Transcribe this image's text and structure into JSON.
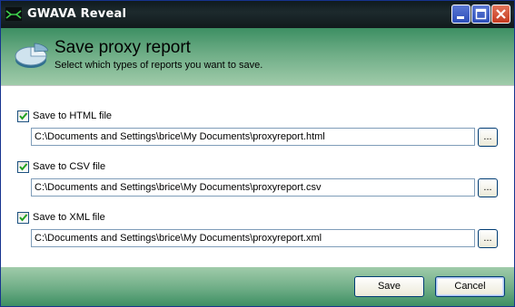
{
  "window": {
    "title": "GWAVA Reveal"
  },
  "header": {
    "title": "Save proxy report",
    "subtitle": "Select which types of reports you want to save."
  },
  "options": [
    {
      "label": "Save to HTML file",
      "checked": true,
      "path": "C:\\Documents and Settings\\brice\\My Documents\\proxyreport.html",
      "browse_label": "..."
    },
    {
      "label": "Save to CSV file",
      "checked": true,
      "path": "C:\\Documents and Settings\\brice\\My Documents\\proxyreport.csv",
      "browse_label": "..."
    },
    {
      "label": "Save to XML file",
      "checked": true,
      "path": "C:\\Documents and Settings\\brice\\My Documents\\proxyreport.xml",
      "browse_label": "..."
    }
  ],
  "footer": {
    "save_label": "Save",
    "cancel_label": "Cancel"
  },
  "icons": {
    "app": "gwava-app-icon",
    "header": "pie-chart-icon",
    "minimize": "minimize-icon",
    "maximize": "maximize-icon",
    "close": "close-icon",
    "check": "checkmark-icon"
  },
  "colors": {
    "header_green": "#3d8f63",
    "title_bar": "#1d2a2d",
    "close_red": "#c63a1f"
  }
}
